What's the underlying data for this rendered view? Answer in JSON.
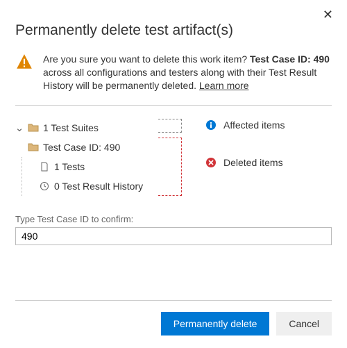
{
  "dialog": {
    "title": "Permanently delete test artifact(s)",
    "warning_prefix": "Are you sure you want to delete this work item? ",
    "warning_bold": "Test Case ID: 490",
    "warning_suffix": " across all configurations and testers along with their Test Result History will be permanently deleted. ",
    "learn_more": "Learn more"
  },
  "tree": {
    "suites_label": "1 Test Suites",
    "case_label": "Test Case ID: 490",
    "tests_label": "1 Tests",
    "history_label": "0 Test Result History"
  },
  "legend": {
    "affected": "Affected items",
    "deleted": "Deleted items"
  },
  "confirm": {
    "label": "Type Test Case ID to confirm:",
    "value": "490"
  },
  "buttons": {
    "primary": "Permanently delete",
    "cancel": "Cancel"
  }
}
